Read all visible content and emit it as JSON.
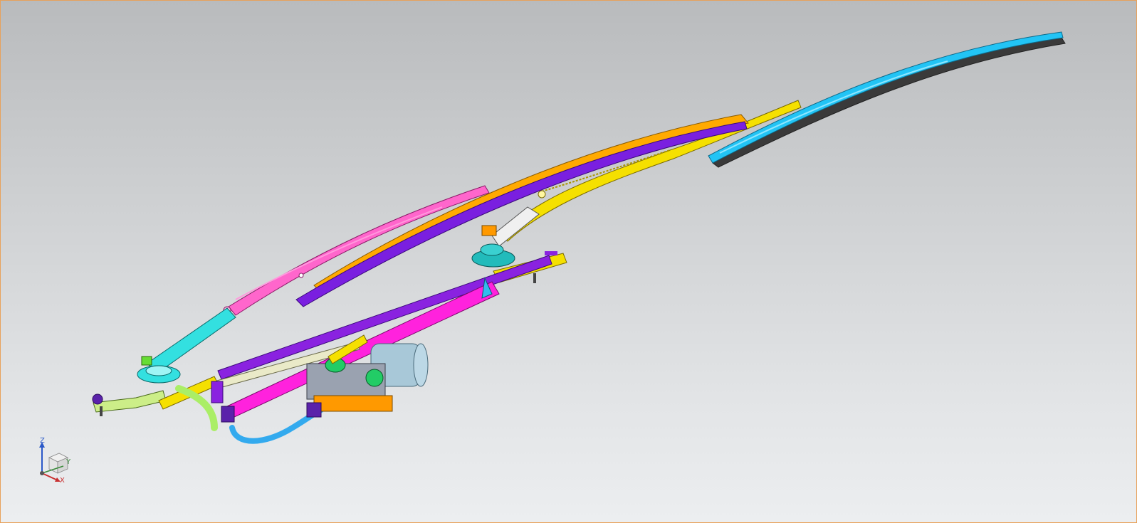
{
  "viewport": {
    "background_top": "#b9bbbd",
    "background_bottom": "#eceef0",
    "border_color": "#e8a15a"
  },
  "triad": {
    "z_label": "Z",
    "y_label": "Y",
    "x_label": "X",
    "z_color": "#2a58c8",
    "y_color": "#3a8a3a",
    "x_color": "#c83030"
  },
  "parts": {
    "left_arm": "#ff66cc",
    "left_blade": "#7a1fe0",
    "left_arm_base": "#33e0e0",
    "right_arm_yellow": "#f5d800",
    "right_arm_orange": "#ffaa00",
    "right_blade": "#22c4f5",
    "linkage_rod_magenta": "#ff22dd",
    "linkage_rod_purple": "#8a22e0",
    "motor_body": "#a8c8d8",
    "motor_bracket": "#ff9900",
    "hose_blue": "#33aaee",
    "hose_green": "#aaee66"
  }
}
